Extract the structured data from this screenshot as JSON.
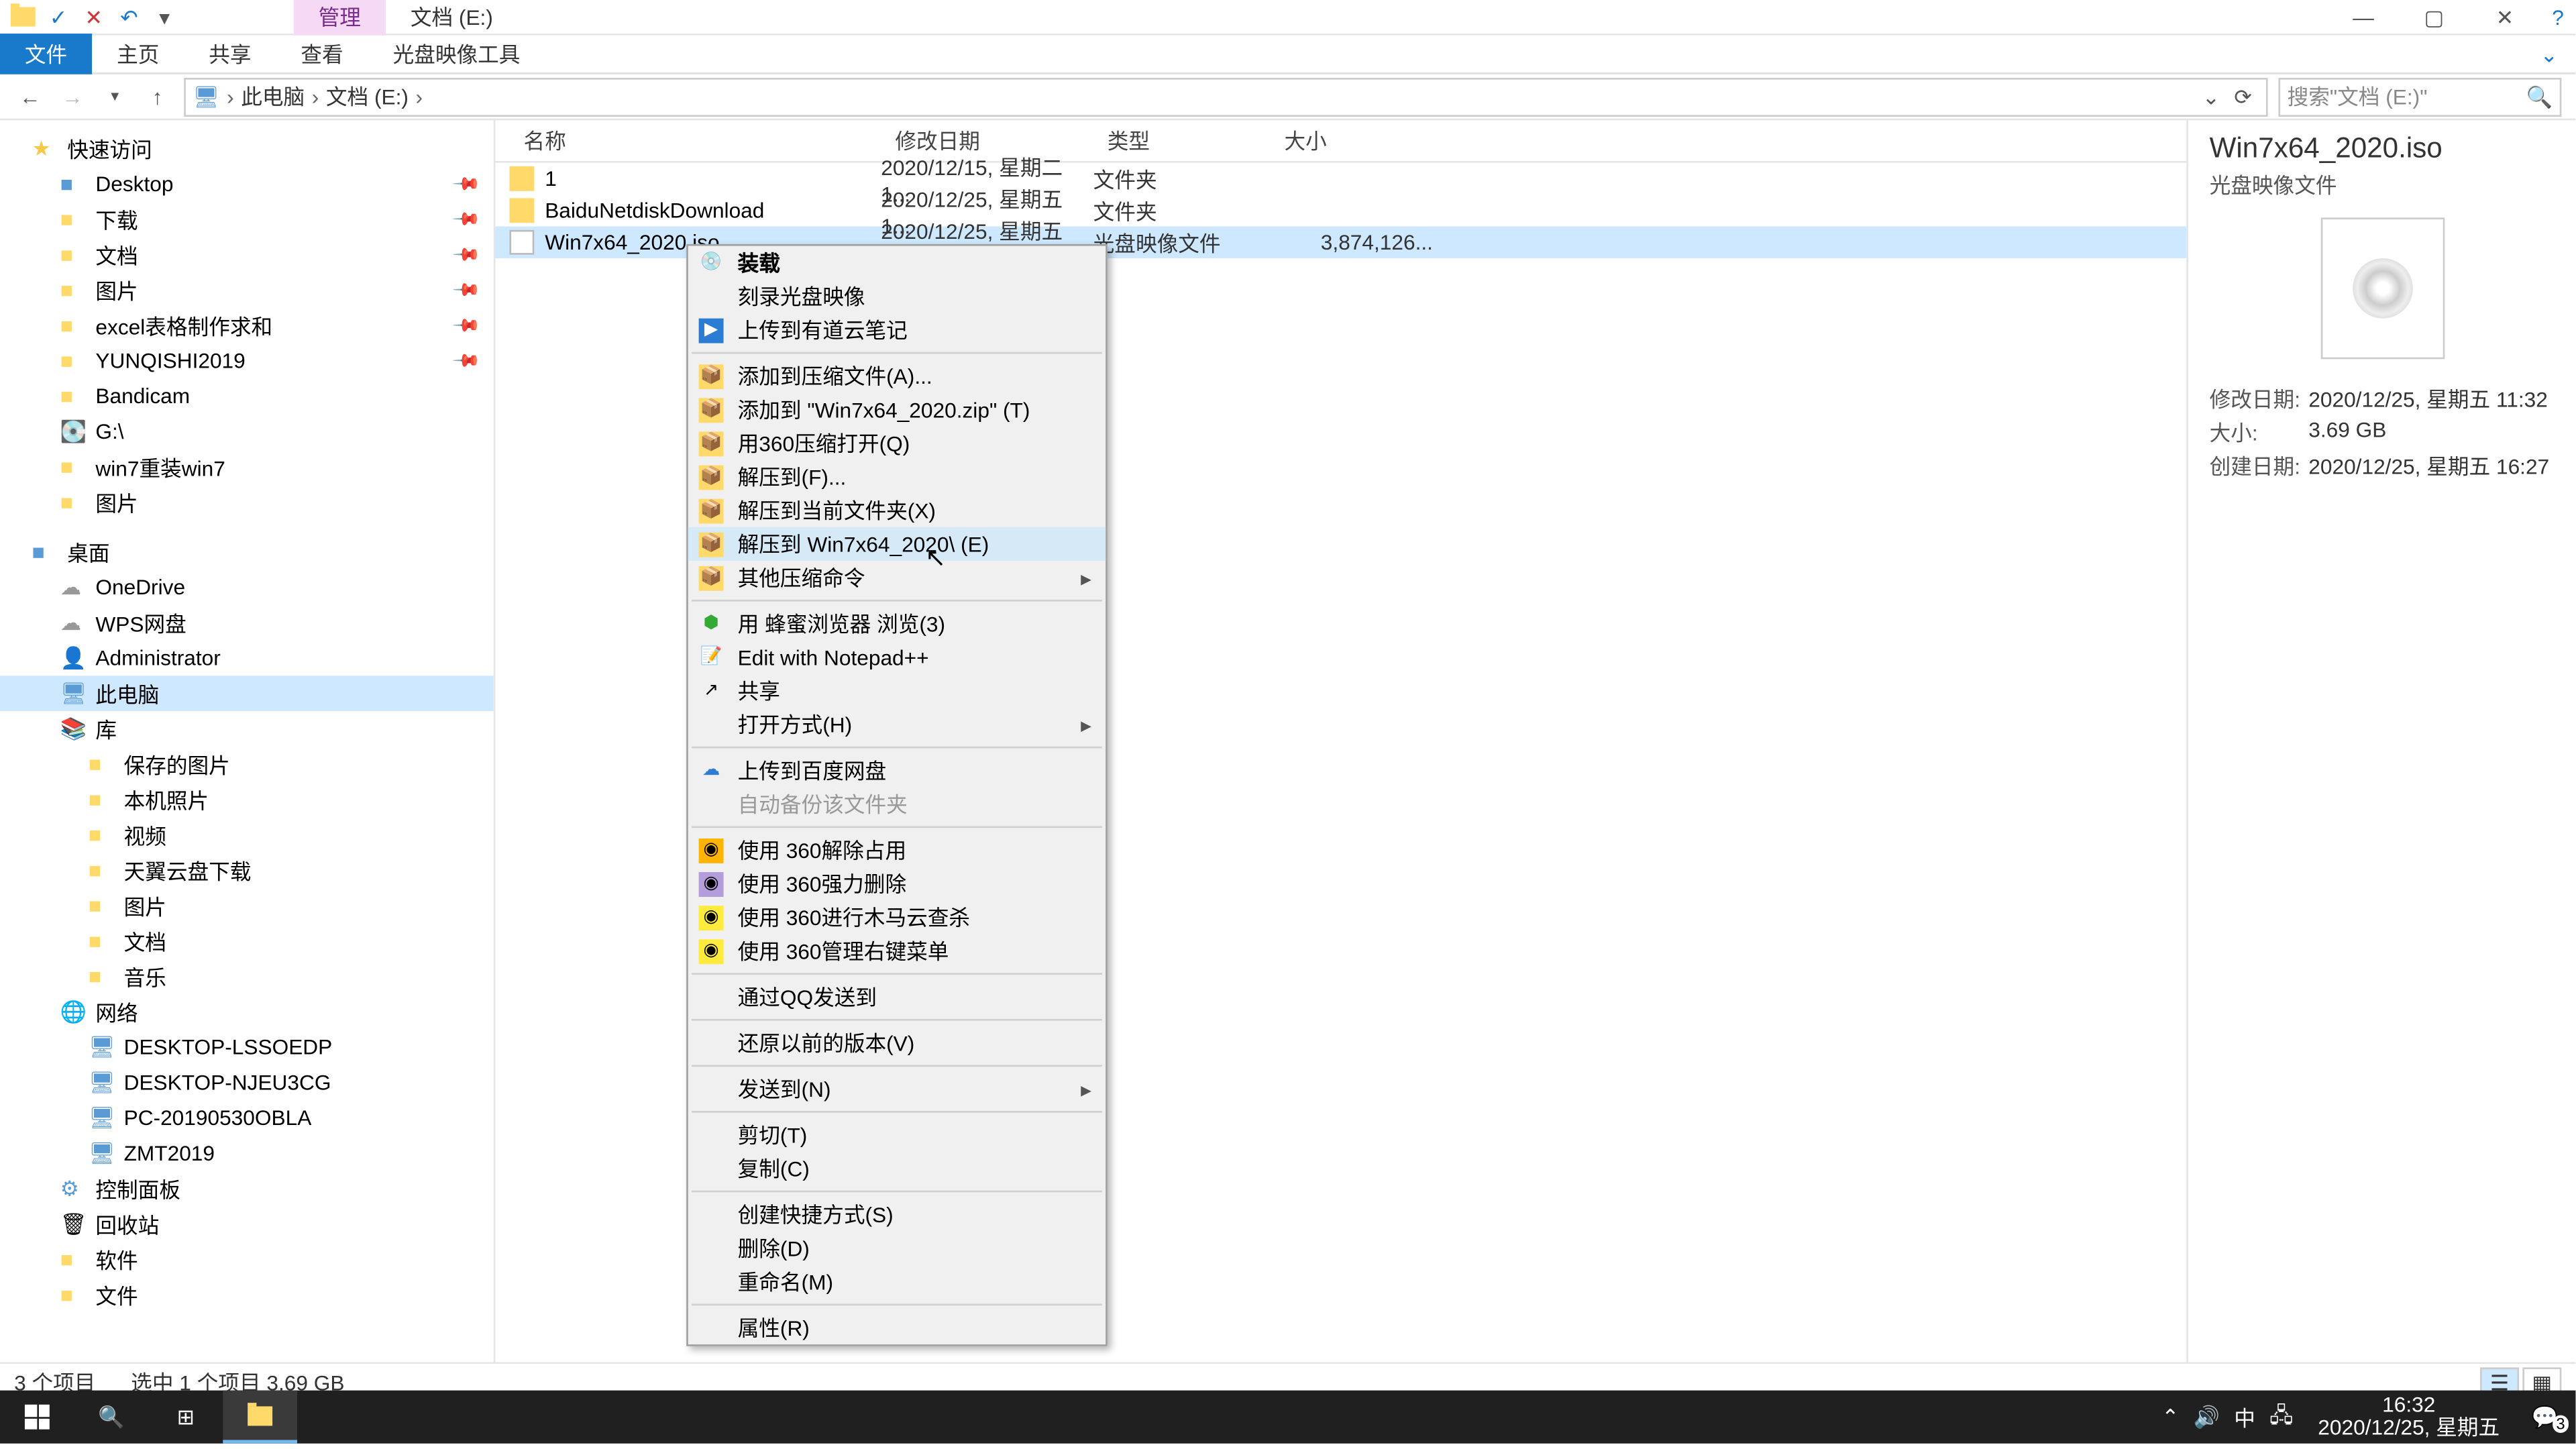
{
  "titlebar": {
    "mgmt": "管理",
    "title": "文档 (E:)"
  },
  "ribbon": {
    "file": "文件",
    "home": "主页",
    "share": "共享",
    "view": "查看",
    "iso": "光盘映像工具"
  },
  "address": {
    "pc": "此电脑",
    "drive": "文档 (E:)"
  },
  "search": {
    "placeholder": "搜索\"文档 (E:)\""
  },
  "tree": {
    "quick": "快速访问",
    "desktop": "Desktop",
    "downloads": "下载",
    "docs": "文档",
    "pics": "图片",
    "excel": "excel表格制作求和",
    "yun": "YUNQISHI2019",
    "bandi": "Bandicam",
    "gdrive": "G:\\",
    "win7": "win7重装win7",
    "pics2": "图片",
    "desktop2": "桌面",
    "onedrive": "OneDrive",
    "wps": "WPS网盘",
    "admin": "Administrator",
    "thispc": "此电脑",
    "lib": "库",
    "savedpic": "保存的图片",
    "localpic": "本机照片",
    "video": "视频",
    "tywp": "天翼云盘下载",
    "pics3": "图片",
    "docs2": "文档",
    "music": "音乐",
    "network": "网络",
    "pc1": "DESKTOP-LSSOEDP",
    "pc2": "DESKTOP-NJEU3CG",
    "pc3": "PC-20190530OBLA",
    "pc4": "ZMT2019",
    "cp": "控制面板",
    "recycle": "回收站",
    "soft": "软件",
    "files": "文件"
  },
  "cols": {
    "name": "名称",
    "date": "修改日期",
    "type": "类型",
    "size": "大小"
  },
  "rows": [
    {
      "name": "1",
      "date": "2020/12/15, 星期二 1...",
      "type": "文件夹",
      "size": ""
    },
    {
      "name": "BaiduNetdiskDownload",
      "date": "2020/12/25, 星期五 1...",
      "type": "文件夹",
      "size": ""
    },
    {
      "name": "Win7x64_2020.iso",
      "date": "2020/12/25, 星期五 1...",
      "type": "光盘映像文件",
      "size": "3,874,126..."
    }
  ],
  "menu": {
    "mount": "装载",
    "burn": "刻录光盘映像",
    "youdao": "上传到有道云笔记",
    "addarc": "添加到压缩文件(A)...",
    "addzip": "添加到 \"Win7x64_2020.zip\" (T)",
    "open360": "用360压缩打开(Q)",
    "extf": "解压到(F)...",
    "extcur": "解压到当前文件夹(X)",
    "extto": "解压到 Win7x64_2020\\ (E)",
    "other": "其他压缩命令",
    "bee": "用 蜂蜜浏览器 浏览(3)",
    "npp": "Edit with Notepad++",
    "share": "共享",
    "openwith": "打开方式(H)",
    "baidu": "上传到百度网盘",
    "autobak": "自动备份该文件夹",
    "u360a": "使用 360解除占用",
    "u360b": "使用 360强力删除",
    "u360c": "使用 360进行木马云查杀",
    "u360d": "使用 360管理右键菜单",
    "qq": "通过QQ发送到",
    "restore": "还原以前的版本(V)",
    "sendto": "发送到(N)",
    "cut": "剪切(T)",
    "copy": "复制(C)",
    "shortcut": "创建快捷方式(S)",
    "delete": "删除(D)",
    "rename": "重命名(M)",
    "props": "属性(R)"
  },
  "details": {
    "title": "Win7x64_2020.iso",
    "sub": "光盘映像文件",
    "mdate_l": "修改日期:",
    "mdate": "2020/12/25, 星期五 11:32",
    "size_l": "大小:",
    "size": "3.69 GB",
    "cdate_l": "创建日期:",
    "cdate": "2020/12/25, 星期五 16:27"
  },
  "status": {
    "count": "3 个项目",
    "sel": "选中 1 个项目  3.69 GB"
  },
  "taskbar": {
    "ime": "中",
    "time": "16:32",
    "date": "2020/12/25, 星期五",
    "badge": "3"
  }
}
